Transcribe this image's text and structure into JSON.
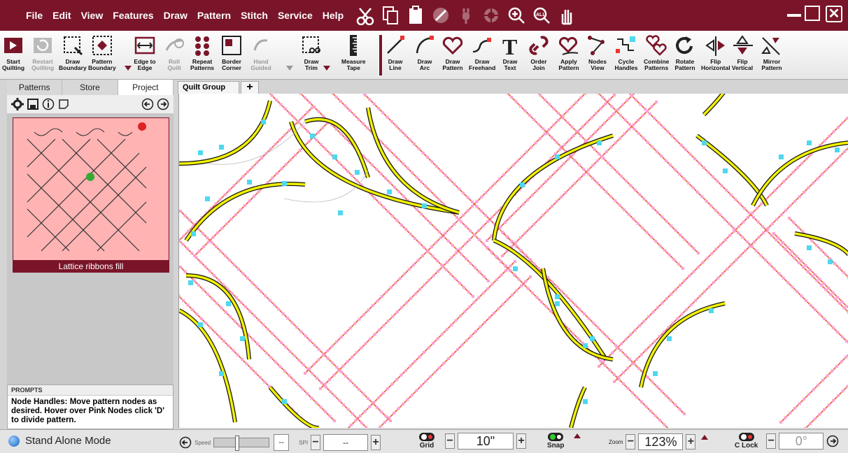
{
  "menubar": {
    "items": [
      "File",
      "Edit",
      "View",
      "Features",
      "Draw",
      "Pattern",
      "Stitch",
      "Service",
      "Help"
    ],
    "icons": [
      "scissors-icon",
      "copy-icon",
      "paste-icon",
      "no-entry-icon",
      "plug-icon",
      "crosshair-icon",
      "zoom-in-icon",
      "zoom-all-icon",
      "hand-icon"
    ]
  },
  "toolbar": {
    "tools": [
      {
        "label": "Start\nQuilting",
        "icon": "start-quilting-icon"
      },
      {
        "label": "Restart\nQuilting",
        "icon": "restart-quilting-icon"
      },
      {
        "label": "Draw\nBoundary",
        "icon": "draw-boundary-icon"
      },
      {
        "label": "Pattern\nBoundary",
        "icon": "pattern-boundary-icon"
      },
      {
        "label": "Edge to\nEdge",
        "icon": "edge-to-edge-icon"
      },
      {
        "label": "Roll\nQuilt",
        "icon": "roll-quilt-icon"
      },
      {
        "label": "Repeat\nPatterns",
        "icon": "repeat-patterns-icon"
      },
      {
        "label": "Border\nCorner",
        "icon": "border-corner-icon"
      },
      {
        "label": "Hand\nGuided",
        "icon": "hand-guided-icon"
      },
      {
        "label": "Draw\nTrim",
        "icon": "draw-trim-icon"
      },
      {
        "label": "Measure\nTape",
        "icon": "measure-tape-icon"
      },
      {
        "label": "Draw\nLine",
        "icon": "draw-line-icon"
      },
      {
        "label": "Draw\nArc",
        "icon": "draw-arc-icon"
      },
      {
        "label": "Draw\nPattern",
        "icon": "draw-pattern-icon"
      },
      {
        "label": "Draw\nFreehand",
        "icon": "draw-freehand-icon"
      },
      {
        "label": "Draw\nText",
        "icon": "draw-text-icon"
      },
      {
        "label": "Order\nJoin",
        "icon": "order-join-icon"
      },
      {
        "label": "Apply\nPattern",
        "icon": "apply-pattern-icon"
      },
      {
        "label": "Nodes\nView",
        "icon": "nodes-view-icon"
      },
      {
        "label": "Cycle\nHandles",
        "icon": "cycle-handles-icon"
      },
      {
        "label": "Combine\nPatterns",
        "icon": "combine-patterns-icon"
      },
      {
        "label": "Rotate\nPattern",
        "icon": "rotate-pattern-icon"
      },
      {
        "label": "Flip\nHorizontal",
        "icon": "flip-horizontal-icon"
      },
      {
        "label": "Flip\nVertical",
        "icon": "flip-vertical-icon"
      },
      {
        "label": "Mirror\nPattern",
        "icon": "mirror-pattern-icon"
      }
    ]
  },
  "sidepanel": {
    "tabs": [
      "Patterns",
      "Store",
      "Project"
    ],
    "active_tab": "Project",
    "thumbnail_caption": "Lattice ribbons fill"
  },
  "prompts": {
    "header": "PROMPTS",
    "text": "Node Handles: Move pattern nodes as desired. Hover over Pink Nodes click 'D' to divide pattern."
  },
  "doc_tabs": {
    "active": "Quilt Group",
    "close": "×",
    "add": "+"
  },
  "statusbar": {
    "mode": "Stand Alone Mode",
    "speed_label": "Speed",
    "speed_value": "--",
    "spi_label": "SPI",
    "spi_value": "--",
    "grid_label": "Grid",
    "grid_value": "10\"",
    "snap_label": "Snap",
    "zoom_label": "Zoom",
    "zoom_value": "123%",
    "clock_label": "C Lock",
    "angle_value": "0°"
  },
  "colors": {
    "brand": "#7a1529",
    "thumbnail_bg": "#ffb3b3",
    "ribbon_line": "#e8734f",
    "ribbon_node": "#ff9fd6",
    "curve_fill": "#f2f200",
    "handle": "#4fd8f0"
  }
}
